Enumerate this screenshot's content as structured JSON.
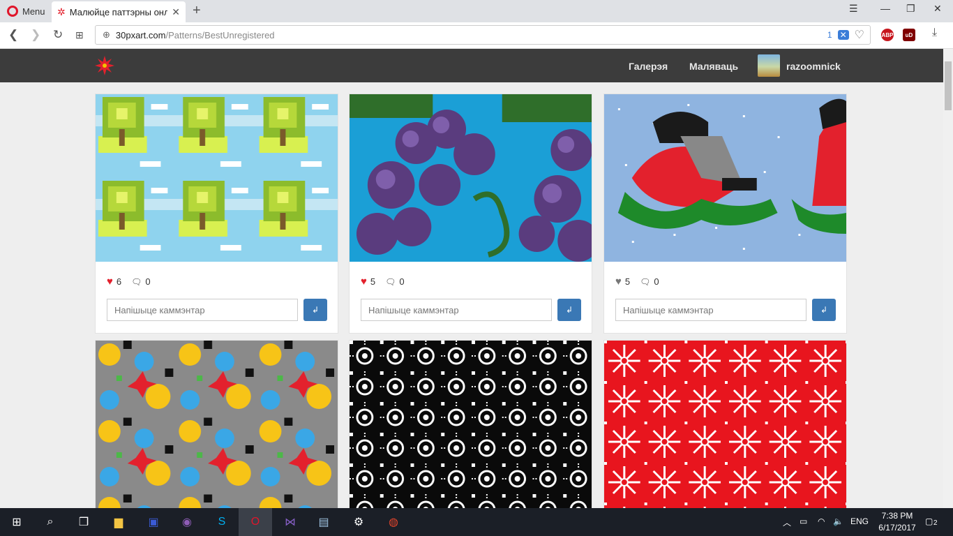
{
  "browser": {
    "menu_label": "Menu",
    "tab_title": "Малюйце паттэрны онлайн",
    "url_host": "30pxart.com",
    "url_path": "/Patterns/BestUnregistered",
    "ext_badge_count": "1",
    "ext_abp": "ABP",
    "ext_ublock": "uD"
  },
  "site": {
    "nav": [
      "Галерэя",
      "Маляваць"
    ],
    "username": "razoomnick",
    "logo": "red-flower-logo"
  },
  "cards": [
    {
      "likes": "6",
      "liked": true,
      "comments": "0",
      "placeholder": "Напішыце каммэнтар",
      "pattern": "trees-pixel"
    },
    {
      "likes": "5",
      "liked": true,
      "comments": "0",
      "placeholder": "Напішыце каммэнтар",
      "pattern": "grapes-knit"
    },
    {
      "likes": "5",
      "liked": false,
      "comments": "0",
      "placeholder": "Напішыце каммэнтар",
      "pattern": "bullfinch-knit"
    },
    {
      "pattern": "yellow-floral"
    },
    {
      "pattern": "black-lace"
    },
    {
      "pattern": "red-snowflakes"
    }
  ],
  "colors": {
    "like": "#e3212d",
    "unliked": "#777777",
    "button": "#3a78b5",
    "header": "#3c3c3c"
  },
  "taskbar": {
    "time": "7:38 PM",
    "date": "6/17/2017",
    "lang": "ENG",
    "notif_count": "2"
  }
}
